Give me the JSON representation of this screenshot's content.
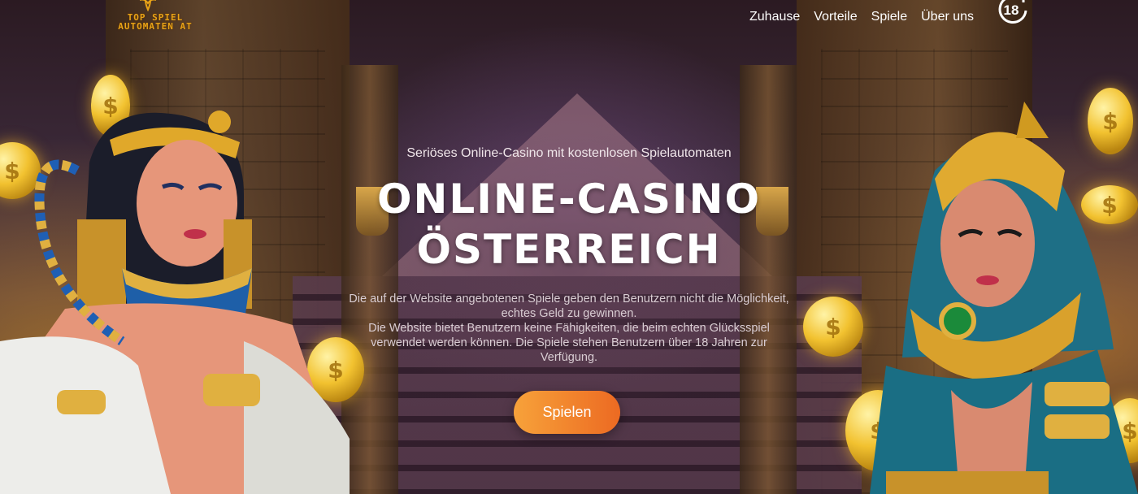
{
  "header": {
    "logo": {
      "line1": "TOP SPIEL",
      "line2": "AUTOMATEN AT",
      "emblem_icon": "winged-scarab-icon"
    },
    "nav": [
      {
        "label": "Zuhause"
      },
      {
        "label": "Vorteile"
      },
      {
        "label": "Spiele"
      },
      {
        "label": "Über uns"
      }
    ],
    "age_badge": {
      "label": "18",
      "icon": "age-restriction-18-plus-icon"
    }
  },
  "hero": {
    "subtitle": "Seriöses Online-Casino mit kostenlosen Spielautomaten",
    "title_line1": "ONLINE-CASINO",
    "title_line2": "ÖSTERREICH",
    "description_1": "Die auf der Website angebotenen Spiele geben den Benutzern nicht die Möglichkeit, echtes Geld zu gewinnen.",
    "description_2": "Die Website bietet Benutzern keine Fähigkeiten, die beim echten Glücksspiel verwendet werden können. Die Spiele stehen Benutzern über 18 Jahren zur Verfügung.",
    "cta_label": "Spielen"
  },
  "colors": {
    "logo_gold": "#e8a317",
    "cta_start": "#f7a23a",
    "cta_end": "#ec6a22",
    "text": "#ffffff"
  }
}
